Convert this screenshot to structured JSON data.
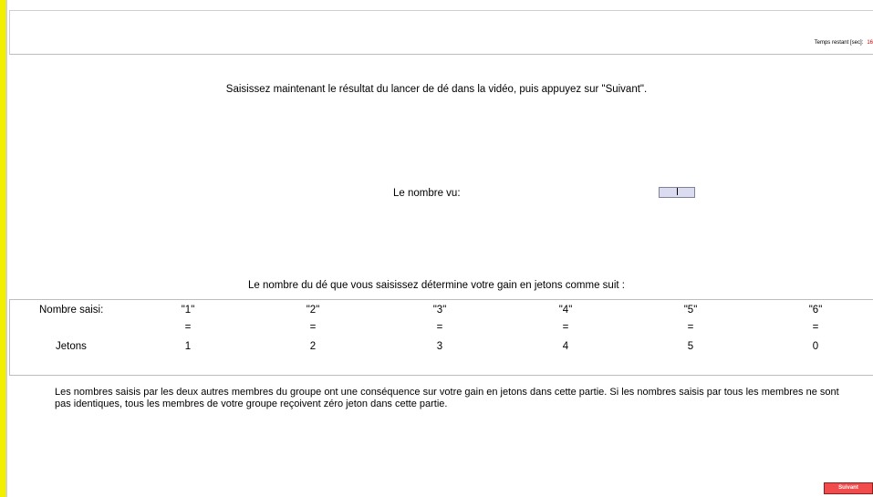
{
  "header": {
    "timer_label": "Temps restant [sec]:",
    "timer_value": "16"
  },
  "instruction": "Saisissez maintenant le résultat du lancer de dé dans la vidéo, puis appuyez sur \"Suivant\".",
  "input": {
    "label": "Le nombre vu:",
    "value": ""
  },
  "gain_caption": "Le nombre du dé que vous saisissez détermine votre gain en jetons comme suit :",
  "table": {
    "row1_label": "Nombre saisi:",
    "row3_label": "Jetons",
    "entries": [
      "\"1\"",
      "\"2\"",
      "\"3\"",
      "\"4\"",
      "\"5\"",
      "\"6\""
    ],
    "equals": [
      "=",
      "=",
      "=",
      "=",
      "=",
      "="
    ],
    "tokens": [
      "1",
      "2",
      "3",
      "4",
      "5",
      "0"
    ]
  },
  "note": "Les nombres saisis par les deux autres membres du groupe ont une conséquence sur votre gain en jetons dans cette partie. Si les nombres saisis par tous les membres ne sont pas identiques, tous les membres de votre groupe reçoivent zéro jeton dans cette partie.",
  "next_button_label": "Suivant",
  "colors": {
    "accent_bar": "#f2ef00",
    "timer_value": "#d00000",
    "next_button": "#f24b4b",
    "input_bg": "#dcdcf0"
  }
}
